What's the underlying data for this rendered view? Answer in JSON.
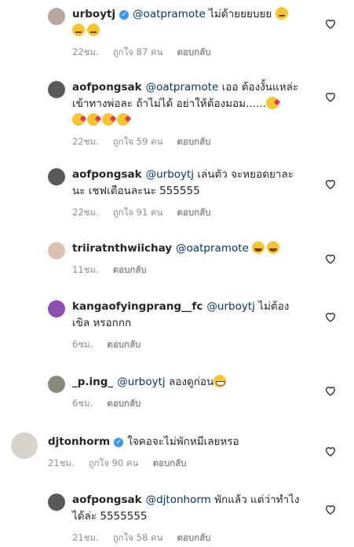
{
  "comments": [
    {
      "user": "urboytj",
      "verified": true,
      "mention": "@oatpramote",
      "text": "ไม่ด้ายยยบยย",
      "emojis": [
        "smirk",
        "smirk",
        "smirk"
      ],
      "time": "22ชม.",
      "likes": "ถูกใจ 87 คน",
      "reply": "ตอบกลับ"
    },
    {
      "user": "aofpongsak",
      "verified": false,
      "mention": "@oatpramote",
      "text": "เออ ต้องงั้นแหล่ะ เข้าทางพ่อละ ถ้าไม่ได้ อย่าให้ต้องมอม......",
      "emojis": [
        "kiss",
        "kiss",
        "kiss",
        "kiss",
        "kiss"
      ],
      "time": "22ชม.",
      "likes": "ถูกใจ 59 คน",
      "reply": "ตอบกลับ"
    },
    {
      "user": "aofpongsak",
      "verified": false,
      "mention": "@urboytj",
      "text": "เล่นตัว จะหยอดยาละนะ เชฟเตือนละนะ 555555",
      "emojis": [],
      "time": "22ชม.",
      "likes": "ถูกใจ 91 คน",
      "reply": "ตอบกลับ"
    },
    {
      "user": "triiratnthwiichay",
      "verified": false,
      "mention": "@oatpramote",
      "text": "",
      "emojis": [
        "laugh",
        "laugh"
      ],
      "time": "11ชม.",
      "likes": "",
      "reply": "ตอบกลับ"
    },
    {
      "user": "kangaofyingprang__fc",
      "verified": false,
      "mention": "@urboytj",
      "text": "ไม่ต้องเขิล หรอกกก",
      "emojis": [],
      "time": "6ชม.",
      "likes": "",
      "reply": "ตอบกลับ"
    },
    {
      "user": "_p.ing_",
      "verified": false,
      "mention": "@urboytj",
      "text": "ลองดูก่อน",
      "emojis": [
        "grin"
      ],
      "time": "6ชม.",
      "likes": "",
      "reply": "ตอบกลับ"
    },
    {
      "user": "djtonhorm",
      "verified": true,
      "mention": "",
      "text": "ใจคอจะไม่พักหมีเลยหรอ",
      "emojis": [],
      "time": "21ชม.",
      "likes": "ถูกใจ 90 คน",
      "reply": "ตอบกลับ"
    },
    {
      "user": "aofpongsak",
      "verified": false,
      "mention": "@djtonhorm",
      "text": "พักแล้ว แต่ว่าทำไงได้ล่ะ 5555555",
      "emojis": [],
      "time": "21ชม.",
      "likes": "ถูกใจ 58 คน",
      "reply": "ตอบกลับ"
    }
  ],
  "colors": {
    "text": "#262626",
    "muted": "#8e8e8e",
    "mention": "#00376b",
    "verified": "#3897f0"
  },
  "icons": {
    "like": "heart-outline-icon",
    "verified": "verified-badge-icon"
  }
}
